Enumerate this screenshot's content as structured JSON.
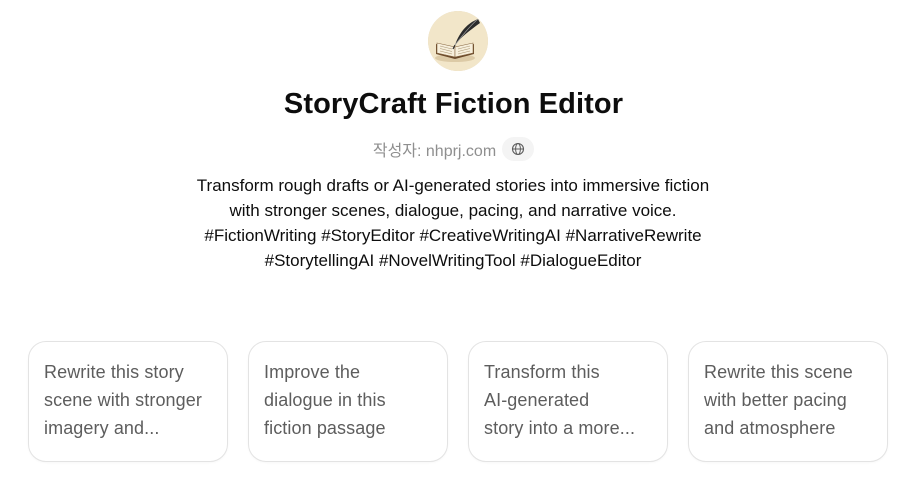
{
  "gpt": {
    "avatar_icon": "book-and-quill-icon",
    "title": "StoryCraft Fiction Editor",
    "author": "작성자: nhprj.com",
    "website_icon": "globe-icon",
    "description_lines": [
      "Transform rough drafts or AI-generated stories into immersive fiction",
      "with stronger scenes, dialogue, pacing, and narrative voice.",
      "#FictionWriting #StoryEditor #CreativeWritingAI #NarrativeRewrite",
      "#StorytellingAI #NovelWritingTool #DialogueEditor"
    ]
  },
  "conversation_starters": [
    {
      "lines": [
        "Rewrite this story",
        "scene with stronger",
        "imagery and..."
      ]
    },
    {
      "lines": [
        "Improve the",
        "dialogue in this",
        "fiction passage"
      ]
    },
    {
      "lines": [
        "Transform this",
        "AI-generated",
        "story into a more..."
      ]
    },
    {
      "lines": [
        "Rewrite this scene",
        "with better pacing",
        "and atmosphere"
      ]
    }
  ],
  "colors": {
    "title": "#0d0d0d",
    "muted_text": "#8f8f8f",
    "card_text": "#5d5d5d",
    "card_border": "#e3e3e3",
    "avatar_background": "#f2e6c9"
  }
}
